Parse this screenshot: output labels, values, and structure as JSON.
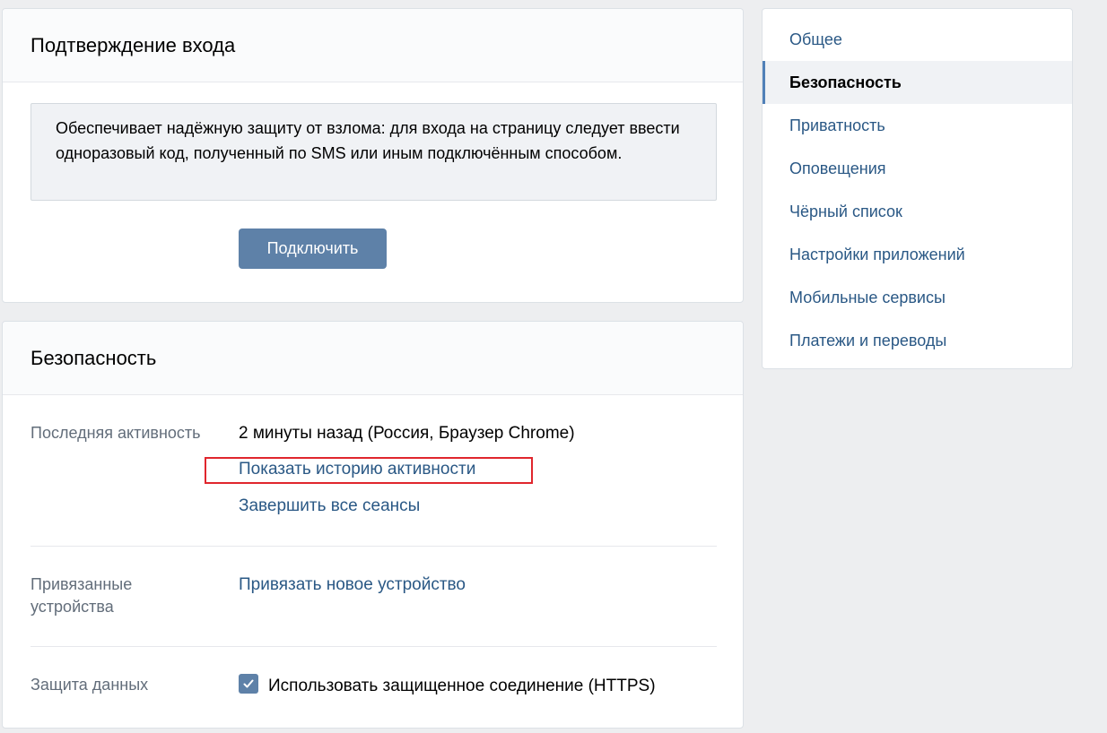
{
  "login_card": {
    "title": "Подтверждение входа",
    "description": "Обеспечивает надёжную защиту от взлома: для входа на страницу следует ввести одноразовый код, полученный по SMS или иным подключённым способом.",
    "button_label": "Подключить"
  },
  "security_card": {
    "title": "Безопасность",
    "last_activity": {
      "label": "Последняя активность",
      "value": "2 минуты назад (Россия, Браузер Chrome)",
      "history_link": "Показать историю активности",
      "end_sessions_link": "Завершить все сеансы"
    },
    "devices": {
      "label": "Привязанные устройства",
      "link": "Привязать новое устройство"
    },
    "data_protection": {
      "label": "Защита данных",
      "checkbox_label": "Использовать защищенное соединение (HTTPS)",
      "checked": true
    }
  },
  "sidebar": {
    "items": [
      {
        "label": "Общее",
        "active": false
      },
      {
        "label": "Безопасность",
        "active": true
      },
      {
        "label": "Приватность",
        "active": false
      },
      {
        "label": "Оповещения",
        "active": false
      },
      {
        "label": "Чёрный список",
        "active": false
      },
      {
        "label": "Настройки приложений",
        "active": false
      },
      {
        "label": "Мобильные сервисы",
        "active": false
      },
      {
        "label": "Платежи и переводы",
        "active": false
      }
    ]
  },
  "colors": {
    "accent": "#5e81a8",
    "link": "#2a5885",
    "highlight": "#e0262d",
    "background": "#edeef0"
  }
}
